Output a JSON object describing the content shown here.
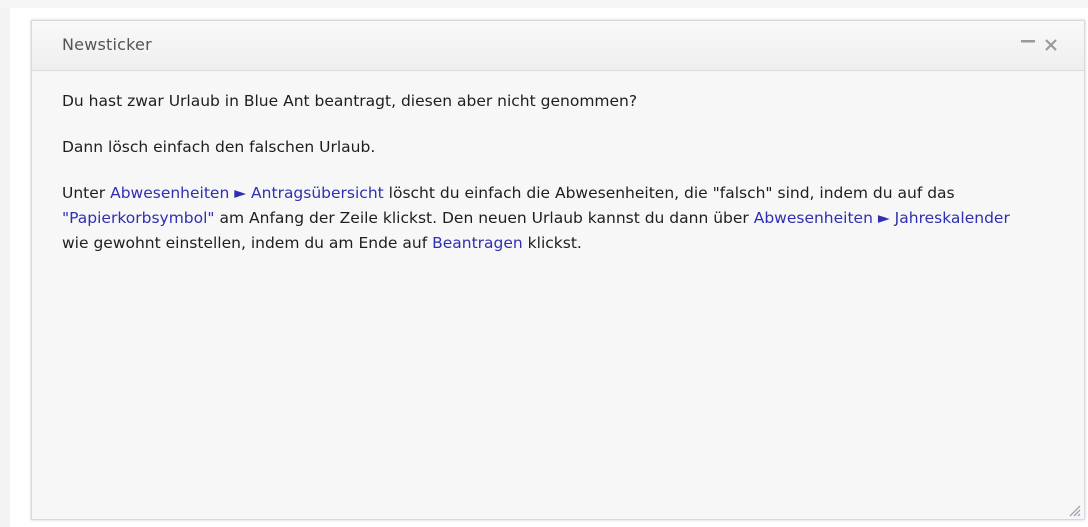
{
  "widget": {
    "title": "Newsticker",
    "minimize_icon": "minimize-icon",
    "close_icon": "close-icon",
    "resize_icon": "resize-grip-icon"
  },
  "body": {
    "para1": "Du hast zwar Urlaub in Blue Ant beantragt, diesen aber nicht genommen?",
    "para2": "Dann lösch einfach den falschen Urlaub.",
    "para3": {
      "t1": "Unter ",
      "link1": "Abwesenheiten ► Antragsübersicht",
      "t2": " löscht du einfach die Abwesenheiten, die \"falsch\" sind, indem du auf das ",
      "link2": "\"Papierkorbsymbol\"",
      "t3": " am Anfang der Zeile klickst. Den neuen Urlaub kannst du dann über ",
      "link3": "Abwesenheiten ► Jahreskalender",
      "t4": " wie gewohnt einstellen, indem du am Ende auf ",
      "link4": "Beantragen",
      "t5": " klickst."
    }
  },
  "colors": {
    "link": "#2f2fb3",
    "text": "#1e1e1e",
    "header_text": "#555555"
  }
}
